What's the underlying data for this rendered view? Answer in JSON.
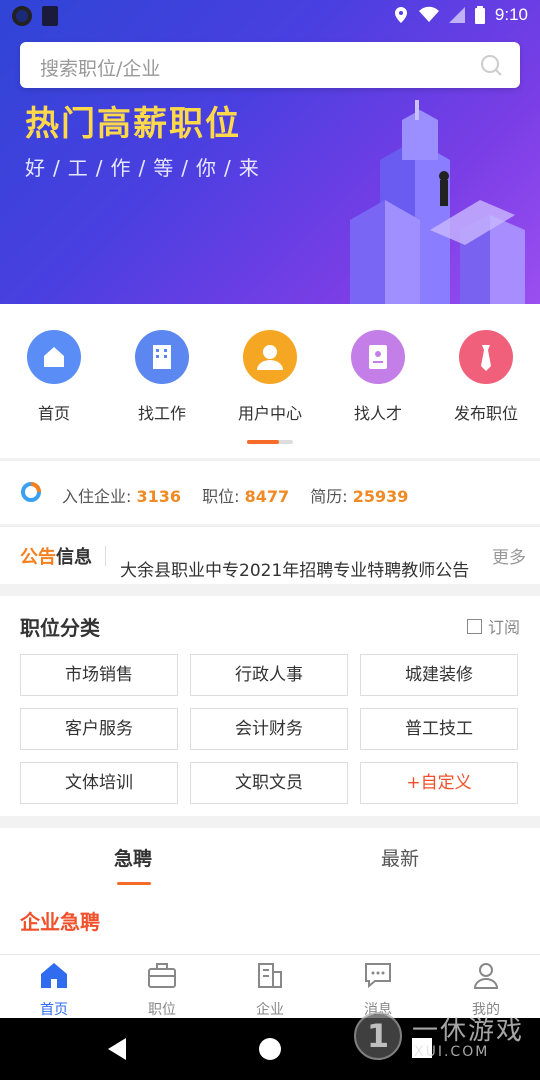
{
  "status_bar": {
    "time": "9:10"
  },
  "search": {
    "placeholder": "搜索职位/企业"
  },
  "banner": {
    "title": "热门高薪职位",
    "subtitle": "好/工/作/等/你/来"
  },
  "icon_nav": [
    {
      "label": "首页",
      "icon": "home-icon",
      "color": "#5b8df6"
    },
    {
      "label": "找工作",
      "icon": "building-icon",
      "color": "#5d87f0"
    },
    {
      "label": "用户中心",
      "icon": "user-icon",
      "color": "#f5a623"
    },
    {
      "label": "找人才",
      "icon": "resume-icon",
      "color": "#c47ee8"
    },
    {
      "label": "发布职位",
      "icon": "tie-icon",
      "color": "#f0607a"
    }
  ],
  "stats": {
    "companies_label": "入住企业:",
    "companies": "3136",
    "jobs_label": "职位:",
    "jobs": "8477",
    "resumes_label": "简历:",
    "resumes": "25939"
  },
  "notice": {
    "logo_part1": "公告",
    "logo_part2": "信息",
    "text": "大余县职业中专2021年招聘专业特聘教师公告",
    "more": "更多"
  },
  "category": {
    "title": "职位分类",
    "subscribe": "订阅",
    "items": [
      "市场销售",
      "行政人事",
      "城建装修",
      "客户服务",
      "会计财务",
      "普工技工",
      "文体培训",
      "文职文员"
    ],
    "custom": "+自定义"
  },
  "tabs": {
    "active": "急聘",
    "other": "最新"
  },
  "urgent_title": "企业急聘",
  "bottom_nav": [
    {
      "label": "首页",
      "icon": "home-icon"
    },
    {
      "label": "职位",
      "icon": "briefcase-icon"
    },
    {
      "label": "企业",
      "icon": "company-icon"
    },
    {
      "label": "消息",
      "icon": "message-icon"
    },
    {
      "label": "我的",
      "icon": "profile-icon"
    }
  ],
  "watermark": {
    "text": "一休游戏",
    "url": "XUI.COM"
  },
  "colors": {
    "accent": "#f56b2a",
    "primary": "#2f6cf0",
    "banner_title": "#ffd94a"
  }
}
